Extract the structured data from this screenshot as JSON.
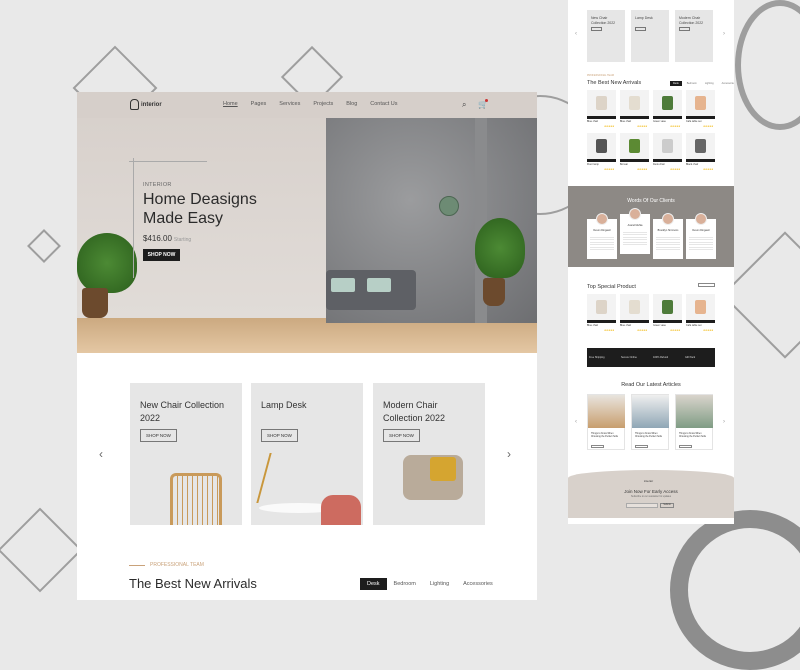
{
  "brand": {
    "name": "interior"
  },
  "nav": {
    "items": [
      "Home",
      "Pages",
      "Services",
      "Projects",
      "Blog",
      "Contact Us"
    ],
    "search_icon": "search-icon",
    "cart_icon": "cart-icon"
  },
  "hero": {
    "eyebrow": "INTERIOR",
    "title": "Home Deasigns Made Easy",
    "price": "$416.00",
    "price_note": "Starting",
    "button": "SHOP NOW"
  },
  "collections": [
    {
      "title": "New Chair Collection 2022",
      "button": "SHOP NOW"
    },
    {
      "title": "Lamp Desk",
      "button": "SHOP NOW"
    },
    {
      "title": "Modern Chair Collection 2022",
      "button": "SHOP NOW"
    }
  ],
  "carousel": {
    "prev_icon": "chevron-left-icon",
    "next_icon": "chevron-right-icon"
  },
  "arrivals": {
    "eyebrow": "PROFESSIONAL TEAM",
    "title": "The Best New Arrivals",
    "tabs": [
      "Desk",
      "Bedroom",
      "Lighting",
      "Accessories"
    ],
    "active_tab": "Desk"
  },
  "preview": {
    "collections": [
      "New Chair Collection 2022",
      "Lamp Desk",
      "Modern Chair Collection 2022"
    ],
    "arrivals_title": "The Best New Arrivals",
    "arrivals_tabs": [
      "Desk",
      "Bedroom",
      "Lighting",
      "Accessories"
    ],
    "products_row1": [
      "Blue chair",
      "Blue chair",
      "Green vase",
      "Café table set"
    ],
    "products_row2": [
      "Floor lamp",
      "Bonsai",
      "Desk chair",
      "Black chair"
    ],
    "clients_title": "Words Of Our Clients",
    "clients": [
      "Devon Dingwell",
      "Anand Mehta",
      "Brooklyn Simmons",
      "Devon Dingwell"
    ],
    "special_title": "Top Special Product",
    "special_products": [
      "Blue chair",
      "Blue chair",
      "Green vase",
      "Café table set"
    ],
    "features": [
      "Free Shipping",
      "Secure Online",
      "100% Refund",
      "Gift Pack"
    ],
    "articles_title": "Read Our Latest Articles",
    "articles": [
      "Things to Know When Choosing the Perfect Sofa",
      "Things to Know When Choosing the Perfect Sofa",
      "Things to Know When Choosing the Perfect Sofa"
    ],
    "join_title": "Join Now For Early Access",
    "join_text": "Subscribe to our newsletter for updates",
    "join_button": "Submit",
    "rating": "★★★★★"
  }
}
